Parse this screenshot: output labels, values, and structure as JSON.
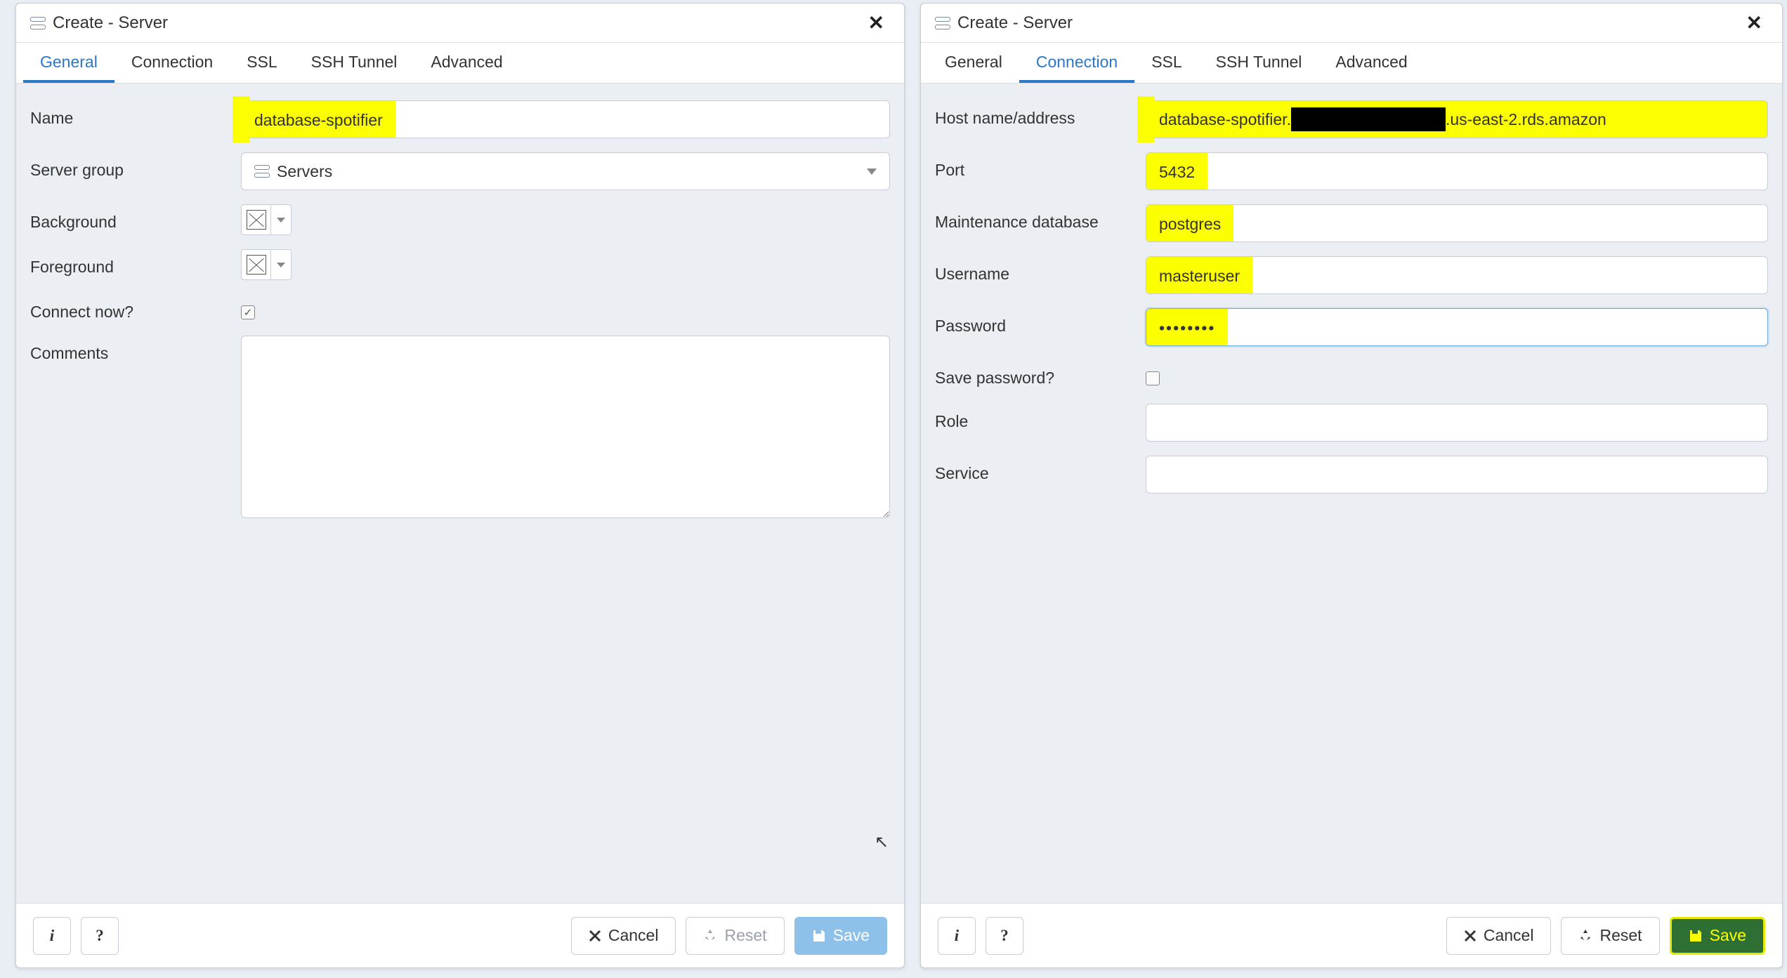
{
  "dialog_title": "Create - Server",
  "tabs": {
    "general": "General",
    "connection": "Connection",
    "ssl": "SSL",
    "ssh_tunnel": "SSH Tunnel",
    "advanced": "Advanced"
  },
  "general": {
    "labels": {
      "name": "Name",
      "server_group": "Server group",
      "background": "Background",
      "foreground": "Foreground",
      "connect_now": "Connect now?",
      "comments": "Comments"
    },
    "values": {
      "name": "database-spotifier",
      "server_group": "Servers",
      "connect_now": true,
      "comments": ""
    }
  },
  "connection": {
    "labels": {
      "host": "Host name/address",
      "port": "Port",
      "maintenance_db": "Maintenance database",
      "username": "Username",
      "password": "Password",
      "save_password": "Save password?",
      "role": "Role",
      "service": "Service"
    },
    "values": {
      "host_prefix": "database-spotifier.",
      "host_suffix": ".us-east-2.rds.amazon",
      "port": "5432",
      "maintenance_db": "postgres",
      "username": "masteruser",
      "password": "••••••••",
      "save_password": false,
      "role": "",
      "service": ""
    }
  },
  "footer": {
    "cancel": "Cancel",
    "reset": "Reset",
    "save": "Save"
  }
}
